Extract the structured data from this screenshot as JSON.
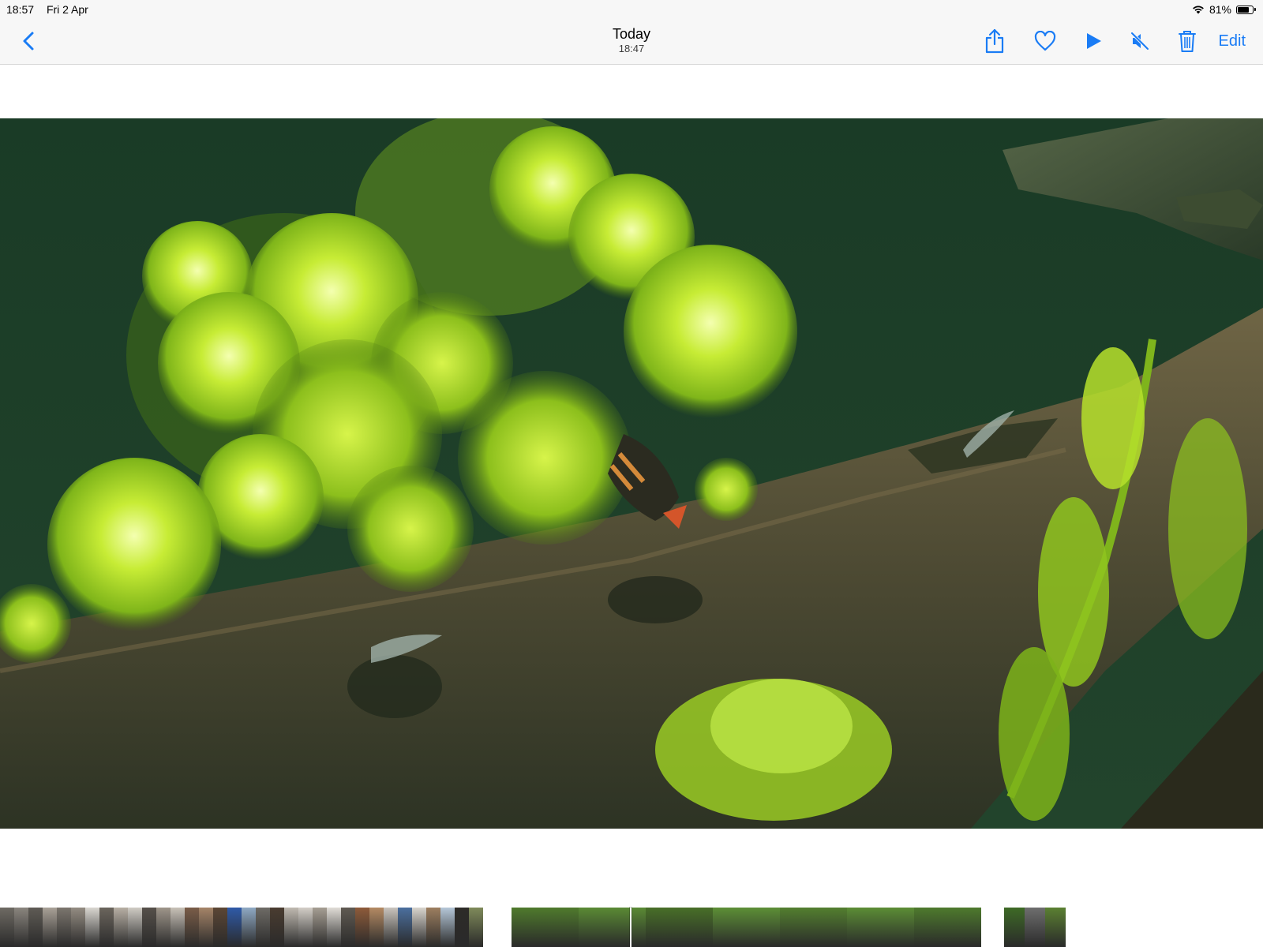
{
  "status_bar": {
    "time": "18:57",
    "date": "Fri 2 Apr",
    "battery": "81%",
    "battery_level": 0.81
  },
  "nav": {
    "title": "Today",
    "subtitle": "18:47",
    "edit_label": "Edit",
    "accent_color": "#1a7cf5",
    "icons": [
      "chevron-left-icon",
      "share-icon",
      "heart-icon",
      "play-icon",
      "speaker-muted-icon",
      "trash-icon"
    ]
  },
  "photo": {
    "subject": "aquarium"
  },
  "filmstrip": {
    "group1_colors": [
      "#6e6a63",
      "#8a857e",
      "#5f5b55",
      "#a9a197",
      "#7c766e",
      "#948c82",
      "#d9d6d0",
      "#6b655d",
      "#b7afa4",
      "#cfcbc4",
      "#56504a",
      "#9e958a",
      "#c8c1b7",
      "#7a5d48",
      "#a58468",
      "#5c4635",
      "#2f5aa8",
      "#8fa9c4",
      "#6e6b66",
      "#4a3c30",
      "#bfb9b0",
      "#d3cec7",
      "#a69e93",
      "#e0dcd6",
      "#605a52",
      "#8e5b3a",
      "#b48a63",
      "#c9c4bd",
      "#4b6f9e",
      "#d8d4cd",
      "#9d7f60",
      "#b5c7d8",
      "#2d2b28",
      "#7f8a5a"
    ],
    "group2_colors": [
      "#4f7a2c",
      "#5a8a34",
      "#486f28",
      "#5d8f36",
      "#537f2f",
      "#5c8d35",
      "#4e7a2d"
    ],
    "group3_colors": [
      "#3e6a26",
      "#6e6e6e",
      "#5b8032"
    ]
  }
}
